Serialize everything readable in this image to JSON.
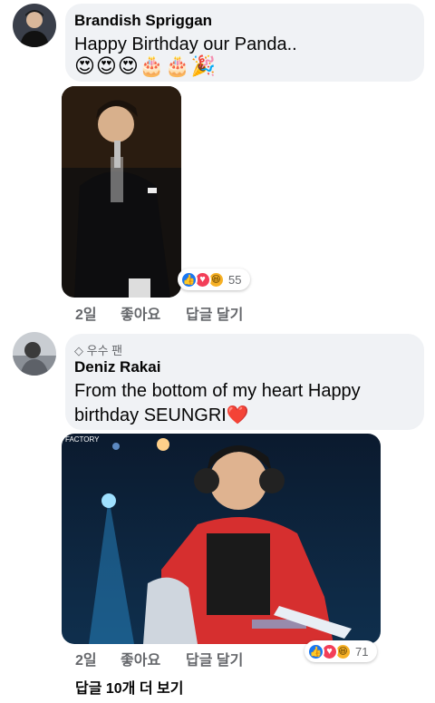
{
  "comments": [
    {
      "author": "Brandish Spriggan",
      "text": "Happy Birthday our Panda..",
      "emojis": "😍😍😍🎂🎂🎉",
      "reactions": {
        "icons": [
          "like-icon",
          "love-icon",
          "haha-icon"
        ],
        "count": "55"
      },
      "actions": {
        "time": "2일",
        "like": "좋아요",
        "reply": "답글 달기"
      }
    },
    {
      "badge": "우수 팬",
      "author": "Deniz Rakai",
      "text_line1": "From the bottom of my heart Happy",
      "text_line2": "birthday SEUNGRI",
      "heart": "❤️",
      "photo_watermark": "FACTORY",
      "reactions": {
        "icons": [
          "like-icon",
          "love-icon",
          "haha-icon"
        ],
        "count": "71"
      },
      "actions": {
        "time": "2일",
        "like": "좋아요",
        "reply": "답글 달기"
      }
    }
  ],
  "view_more_replies": "답글 10개 더 보기",
  "colors": {
    "bubble": "#f0f2f5",
    "secondary_text": "#65676b",
    "like_blue": "#1877f2",
    "love_red": "#f33e58",
    "haha_yellow": "#f7b125"
  }
}
